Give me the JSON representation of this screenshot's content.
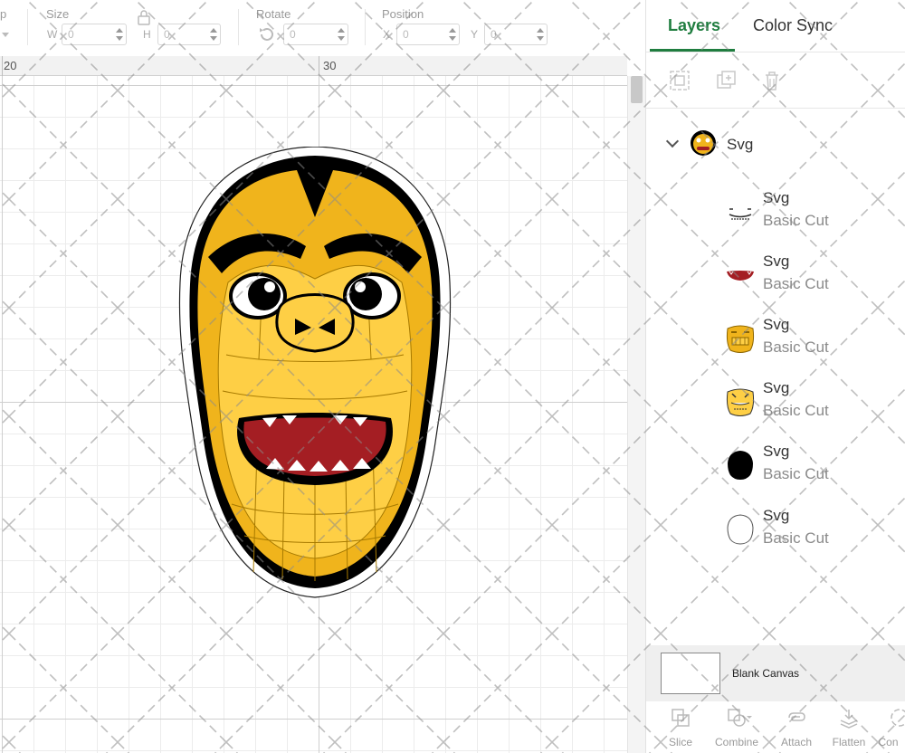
{
  "toolbar": {
    "prev_label": "p",
    "size_label": "Size",
    "w_label": "W",
    "w_value": "0",
    "h_label": "H",
    "h_value": "0",
    "rotate_label": "Rotate",
    "rotate_value": "0",
    "position_label": "Position",
    "x_label": "X",
    "x_value": "0",
    "y_label": "Y",
    "y_value": "0"
  },
  "ruler": {
    "marks": [
      "20",
      "30"
    ]
  },
  "panel": {
    "tabs": [
      {
        "label": "Layers",
        "active": true
      },
      {
        "label": "Color Sync",
        "active": false
      }
    ],
    "group": {
      "name": "Svg"
    },
    "layers": [
      {
        "name": "Svg",
        "type": "Basic Cut",
        "thumb": "teeth-outline-icon"
      },
      {
        "name": "Svg",
        "type": "Basic Cut",
        "thumb": "mouth-red-icon"
      },
      {
        "name": "Svg",
        "type": "Basic Cut",
        "thumb": "face-gold-icon"
      },
      {
        "name": "Svg",
        "type": "Basic Cut",
        "thumb": "face-light-icon"
      },
      {
        "name": "Svg",
        "type": "Basic Cut",
        "thumb": "black-silhouette-icon"
      },
      {
        "name": "Svg",
        "type": "Basic Cut",
        "thumb": "white-silhouette-icon"
      }
    ],
    "blank_canvas_label": "Blank Canvas",
    "bottom_tools": [
      {
        "label": "Slice",
        "icon": "slice-icon"
      },
      {
        "label": "Combine",
        "icon": "combine-icon"
      },
      {
        "label": "Attach",
        "icon": "attach-icon"
      },
      {
        "label": "Flatten",
        "icon": "flatten-icon"
      },
      {
        "label": "Con",
        "icon": "contour-icon"
      }
    ]
  },
  "colors": {
    "accent": "#1f7d3f",
    "gold": "#f0b41c",
    "gold_light": "#fecf45",
    "mouth_red": "#a41e23",
    "black": "#000000"
  }
}
